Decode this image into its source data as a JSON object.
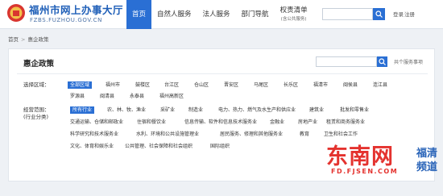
{
  "header": {
    "title": "福州市网上办事大厅",
    "subtitle": "FZBS.FUZHOU.GOV.CN",
    "nav": [
      {
        "label": "首页",
        "active": true
      },
      {
        "label": "自然人服务",
        "active": false
      },
      {
        "label": "法人服务",
        "active": false
      },
      {
        "label": "部门导航",
        "active": false
      }
    ],
    "nav_list": {
      "label": "权责清单",
      "sub": "(含公共服务)"
    },
    "login": "登录",
    "register": "注册",
    "accent_color": "#2a6fd4"
  },
  "breadcrumb": {
    "home": "首页",
    "sep": ">",
    "current": "惠企政策"
  },
  "panel": {
    "title": "惠企政策",
    "public_link": "共个服务事项",
    "region_label": "选择区域：",
    "regions": [
      "全部区域",
      "福州市",
      "鼓楼区",
      "台江区",
      "仓山区",
      "晋安区",
      "马尾区",
      "长乐区",
      "福清市",
      "闽侯县",
      "连江县",
      "罗源县",
      "闽清县",
      "永泰县",
      "福州高新区"
    ],
    "industry_label": "经营范围：",
    "industry_label2": "(行业分类)",
    "industries": [
      "所有行业",
      "农、林、牧、渔业",
      "采矿业",
      "制造业",
      "电力、热力、燃气及水生产和供应业",
      "建筑业",
      "批发和零售业",
      "交通运输、仓储和邮政业",
      "住宿和餐饮业",
      "信息传输、软件和信息技术服务业",
      "金融业",
      "房地产业",
      "租赁和商务服务业",
      "科学研究和技术服务业",
      "水利、环境和公共设施管理业",
      "居民服务、修理和其他服务业",
      "教育",
      "卫生和社会工作",
      "文化、体育和娱乐业",
      "公共管理、社会保障和社会组织",
      "国际组织"
    ]
  },
  "watermark": {
    "main": "东南网",
    "url": "FD.FJSEN.COM",
    "side1": "福清",
    "side2": "频道"
  }
}
